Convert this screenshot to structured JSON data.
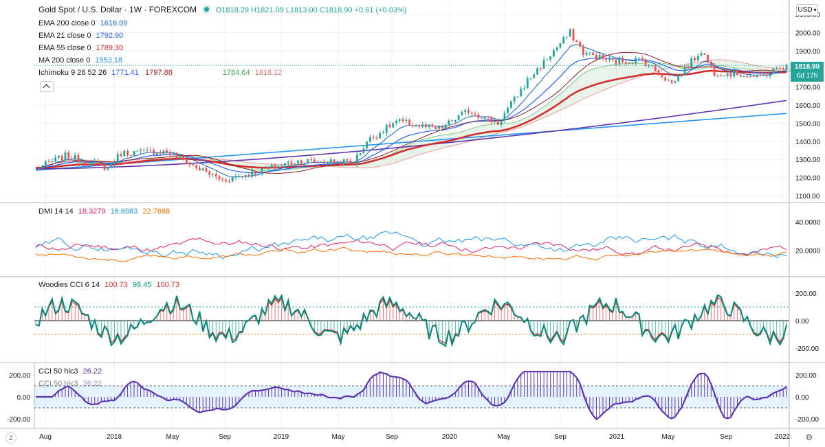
{
  "header": {
    "symbol": "Gold Spot / U.S. Dollar · 1W · FOREXCOM",
    "ohlc": "O1818.29 H1821.09 L1813.00 C1818.90 +0.61 (+0.03%)",
    "currency": "USD"
  },
  "indicators": [
    {
      "label": "EMA 200 close 0",
      "value": "1616.09",
      "color": "#1e66c8"
    },
    {
      "label": "EMA 21 close 0",
      "value": "1792.90",
      "color": "#2962ff"
    },
    {
      "label": "EMA 55 close 0",
      "value": "1789.30",
      "color": "#d32f2f"
    },
    {
      "label": "MA 200 close 0",
      "value": "1553.18",
      "color": "#2196f3"
    }
  ],
  "ichimoku": {
    "label": "Ichimoku 9 26 52 26",
    "v1": "1771.41",
    "v2": "1797.88",
    "v3": "1784.64",
    "v4": "1818.12"
  },
  "price_axis": {
    "ticks": [
      "2100.00",
      "2000.00",
      "1900.00",
      "1800.00",
      "1700.00",
      "1600.00",
      "1500.00",
      "1400.00",
      "1300.00",
      "1200.00",
      "1100.00"
    ],
    "last_price": "1818.90",
    "countdown": "6d 17h"
  },
  "dmi": {
    "label": "DMI 14 14",
    "v1": "18.3279",
    "v2": "16.6983",
    "v3": "22.7688",
    "ticks": [
      "40.0000",
      "20.0000"
    ]
  },
  "woodies": {
    "label": "Woodies CCI 6 14",
    "v1": "100.73",
    "v2": "96.45",
    "v3": "100.73",
    "ticks": [
      "200.00",
      "0.00",
      "-200.00"
    ]
  },
  "cci": {
    "label": "CCI 50 hlc3",
    "value": "26.22",
    "ticks": [
      "200.00",
      "0.00",
      "-200.00"
    ]
  },
  "time_axis": [
    "Aug",
    "2018",
    "May",
    "Sep",
    "2019",
    "May",
    "Sep",
    "2020",
    "May",
    "Sep",
    "2021",
    "May",
    "Sep",
    "2022"
  ],
  "colors": {
    "up": "#26a69a",
    "down": "#ef5350",
    "grid": "#eef0f3"
  },
  "chart_data": {
    "type": "candlestick",
    "title": "Gold Spot / U.S. Dollar",
    "x_range": [
      "2017-07",
      "2021-11"
    ],
    "ylim": [
      1100,
      2100
    ],
    "anchors": [
      [
        "2017-07",
        1250
      ],
      [
        "2017-09",
        1320
      ],
      [
        "2017-12",
        1255
      ],
      [
        "2018-01",
        1335
      ],
      [
        "2018-04",
        1345
      ],
      [
        "2018-06",
        1265
      ],
      [
        "2018-08",
        1185
      ],
      [
        "2018-10",
        1225
      ],
      [
        "2019-01",
        1290
      ],
      [
        "2019-05",
        1285
      ],
      [
        "2019-06",
        1400
      ],
      [
        "2019-08",
        1510
      ],
      [
        "2019-11",
        1465
      ],
      [
        "2020-01",
        1570
      ],
      [
        "2020-03",
        1500
      ],
      [
        "2020-05",
        1735
      ],
      [
        "2020-08",
        2000
      ],
      [
        "2020-09",
        1890
      ],
      [
        "2020-11",
        1840
      ],
      [
        "2021-01",
        1850
      ],
      [
        "2021-03",
        1720
      ],
      [
        "2021-05",
        1900
      ],
      [
        "2021-06",
        1780
      ],
      [
        "2021-08",
        1770
      ],
      [
        "2021-09",
        1750
      ],
      [
        "2021-11",
        1818.9
      ]
    ]
  }
}
